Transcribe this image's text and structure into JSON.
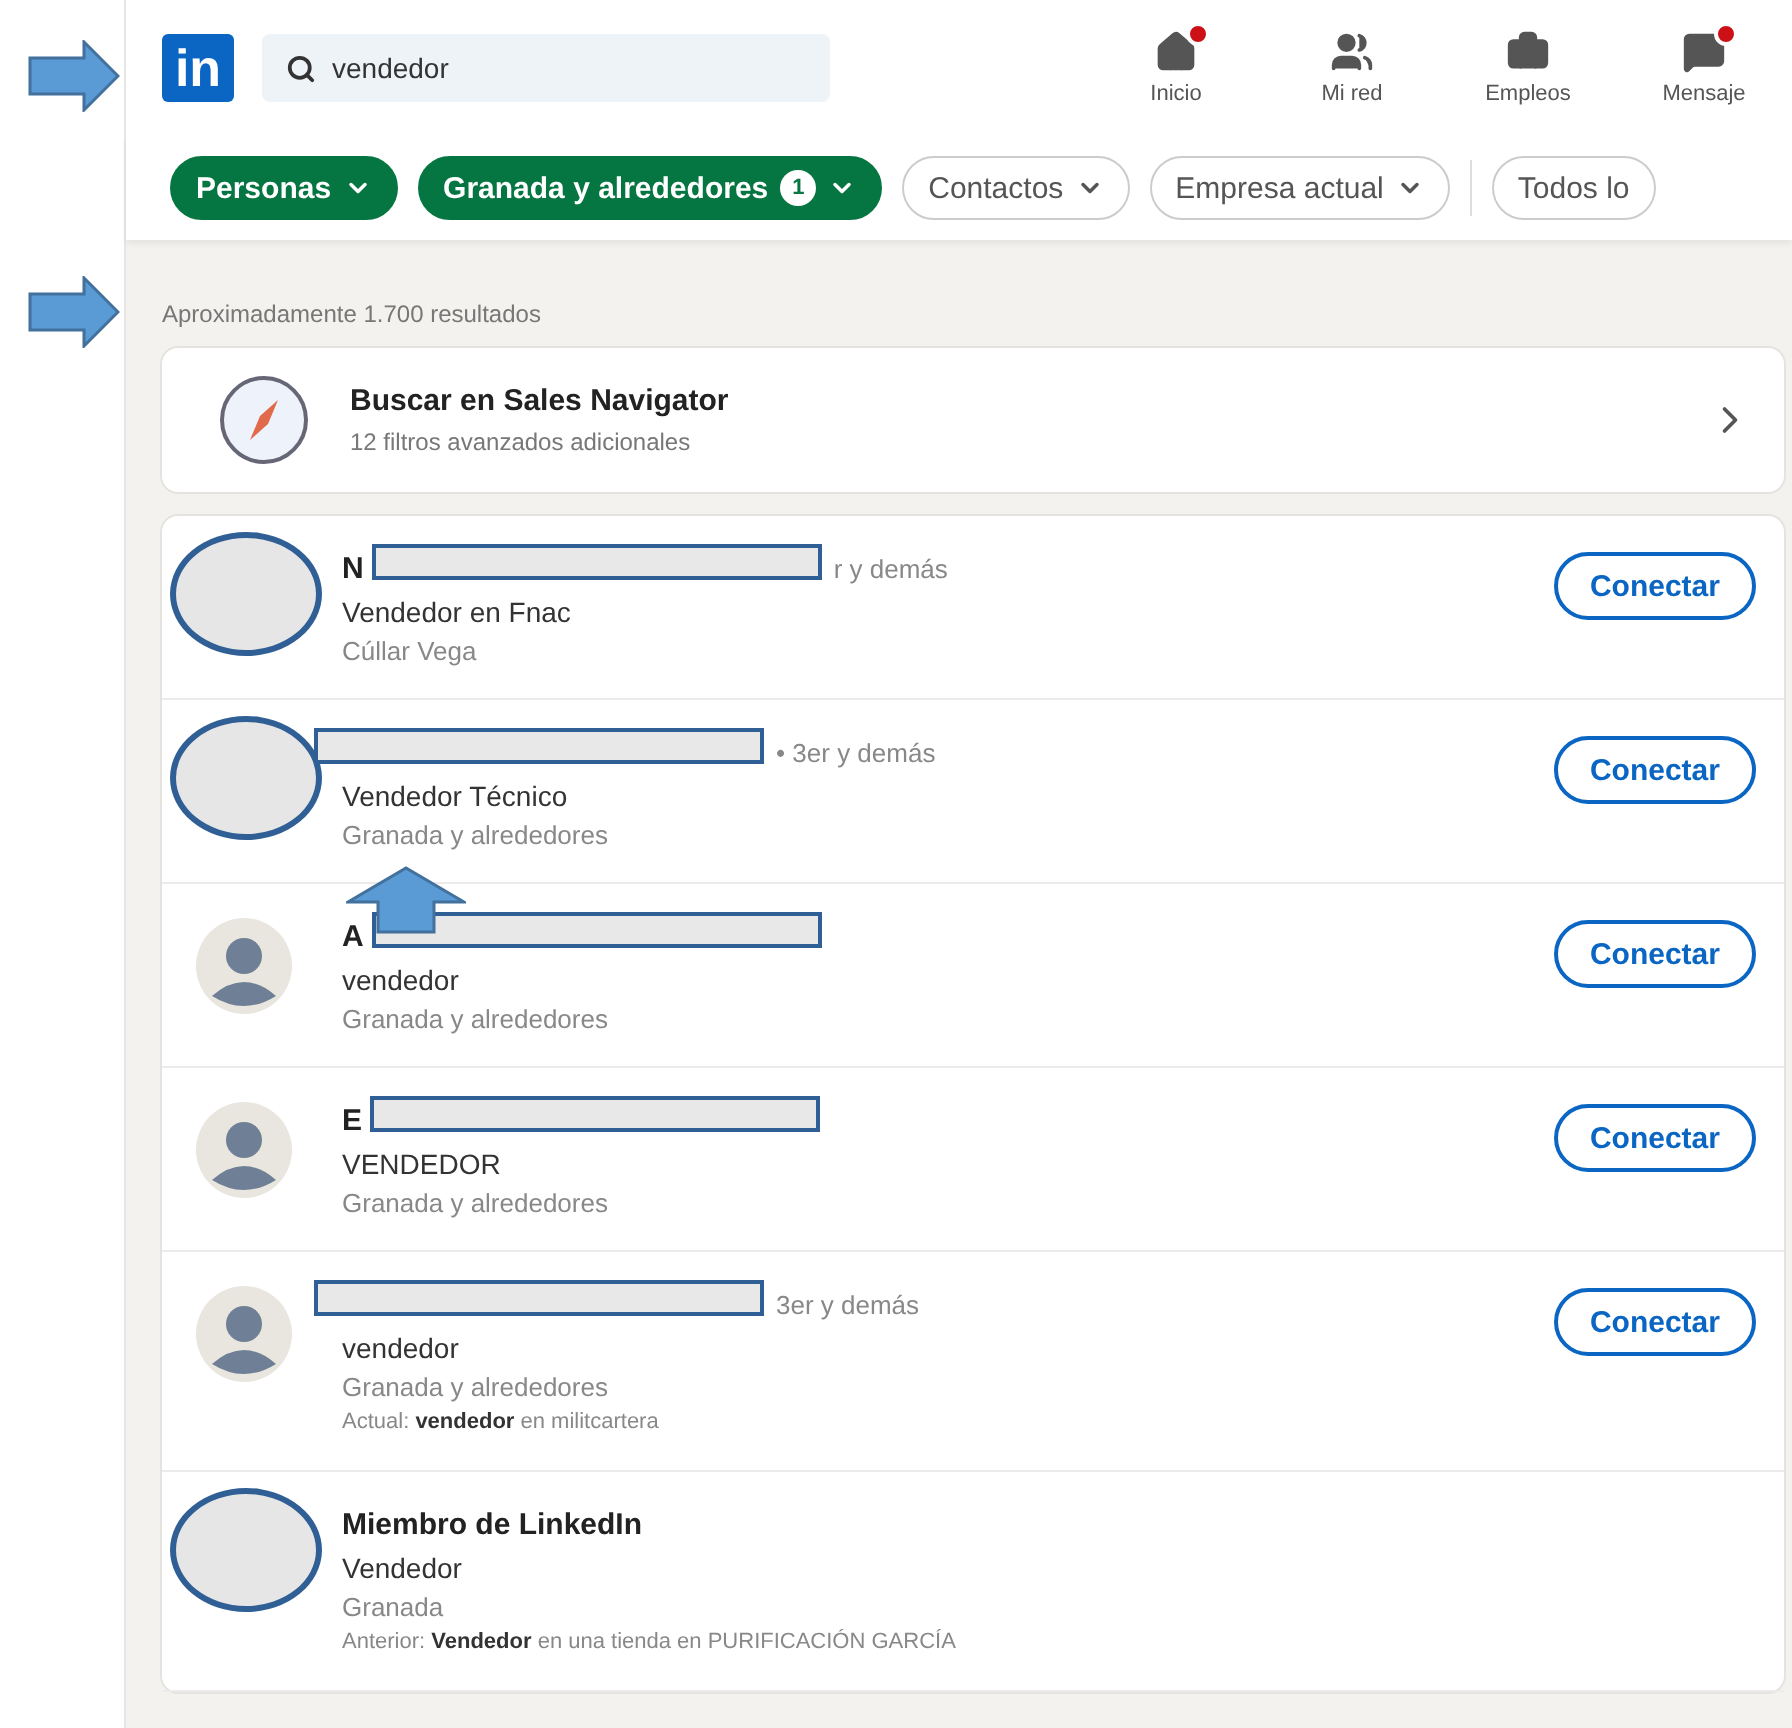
{
  "logo": "in",
  "search": {
    "value": "vendedor"
  },
  "nav": [
    {
      "label": "Inicio",
      "badge": true
    },
    {
      "label": "Mi red",
      "badge": false
    },
    {
      "label": "Empleos",
      "badge": false
    },
    {
      "label": "Mensaje",
      "badge": true
    }
  ],
  "filters": [
    {
      "label": "Personas",
      "selected": true
    },
    {
      "label": "Granada y alrededores",
      "selected": true,
      "count": "1"
    },
    {
      "label": "Contactos",
      "selected": false
    },
    {
      "label": "Empresa actual",
      "selected": false
    },
    {
      "label": "Todos lo",
      "selected": false,
      "divider_before": true
    }
  ],
  "results_count": "Aproximadamente 1.700 resultados",
  "sales_navigator": {
    "title": "Buscar en Sales Navigator",
    "subtitle": "12 filtros avanzados adicionales"
  },
  "results": [
    {
      "avatar_covered": true,
      "name_redacted": true,
      "name": "N",
      "degree": "r y demás",
      "headline": "Vendedor en Fnac",
      "location": "Cúllar Vega",
      "button": "Conectar"
    },
    {
      "avatar_covered": true,
      "name_redacted": true,
      "degree": "• 3er y demás",
      "headline": "Vendedor Técnico",
      "location": "Granada y alrededores",
      "button": "Conectar"
    },
    {
      "avatar_covered": false,
      "name_redacted": true,
      "name": "A",
      "headline": "vendedor",
      "location": "Granada y alrededores",
      "button": "Conectar"
    },
    {
      "avatar_covered": false,
      "name_redacted": true,
      "name": "E",
      "headline": "VENDEDOR",
      "location": "Granada y alrededores",
      "button": "Conectar"
    },
    {
      "avatar_covered": false,
      "name_redacted": true,
      "degree": "3er y demás",
      "headline": "vendedor",
      "location": "Granada y alrededores",
      "note": "Actual: **vendedor** en militcartera",
      "button": "Conectar"
    },
    {
      "avatar_covered": true,
      "name_redacted": false,
      "name": "Miembro de LinkedIn",
      "headline": "Vendedor",
      "location": "Granada",
      "note": "Anterior: **Vendedor** en una tienda en PURIFICACIÓN GARCÍA"
    }
  ]
}
